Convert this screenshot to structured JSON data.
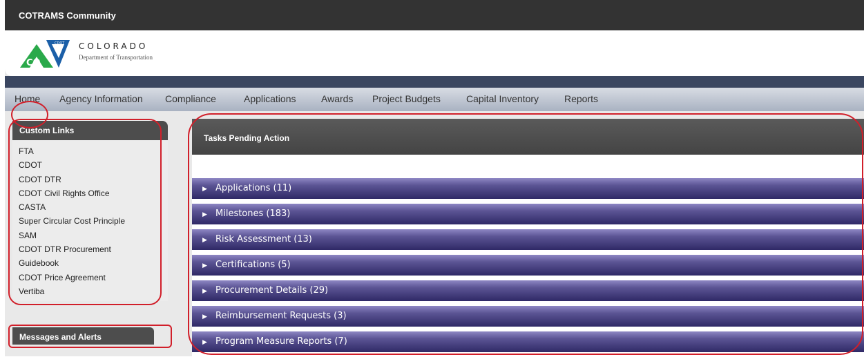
{
  "app": {
    "title": "COTRAMS Community"
  },
  "logo": {
    "state": "COLORADO",
    "department": "Department of Transportation",
    "badge_text": "CDOT",
    "co_text": "CO"
  },
  "nav": {
    "items": [
      "Home",
      "Agency Information",
      "Compliance",
      "Applications",
      "Awards",
      "Project Budgets",
      "Capital Inventory",
      "Reports"
    ]
  },
  "sidebar": {
    "custom_links_title": "Custom Links",
    "links": [
      "FTA",
      "CDOT",
      "CDOT DTR",
      "CDOT Civil Rights Office",
      "CASTA",
      "Super Circular Cost Principle",
      "SAM",
      "CDOT DTR Procurement",
      "Guidebook",
      "CDOT Price Agreement",
      "Vertiba"
    ],
    "messages_title": "Messages and Alerts"
  },
  "tasks": {
    "title": "Tasks Pending Action",
    "items": [
      "Applications (11)",
      "Milestones (183)",
      "Risk Assessment (13)",
      "Certifications (5)",
      "Procurement Details (29)",
      "Reimbursement Requests (3)",
      "Program Measure Reports (7)"
    ]
  },
  "colors": {
    "topbar": "#333333",
    "nav_gradient_top": "#d8dce4",
    "nav_gradient_bottom": "#a9b2c2",
    "accordion_top": "#8e87c4",
    "accordion_bottom": "#2f2966",
    "annotation_red": "#d11f2a",
    "logo_green": "#2aa94a",
    "logo_blue": "#1b5fa8"
  },
  "icons": {
    "accordion": "caret-right-icon",
    "logo": "cdot-mountain-logo-icon"
  }
}
